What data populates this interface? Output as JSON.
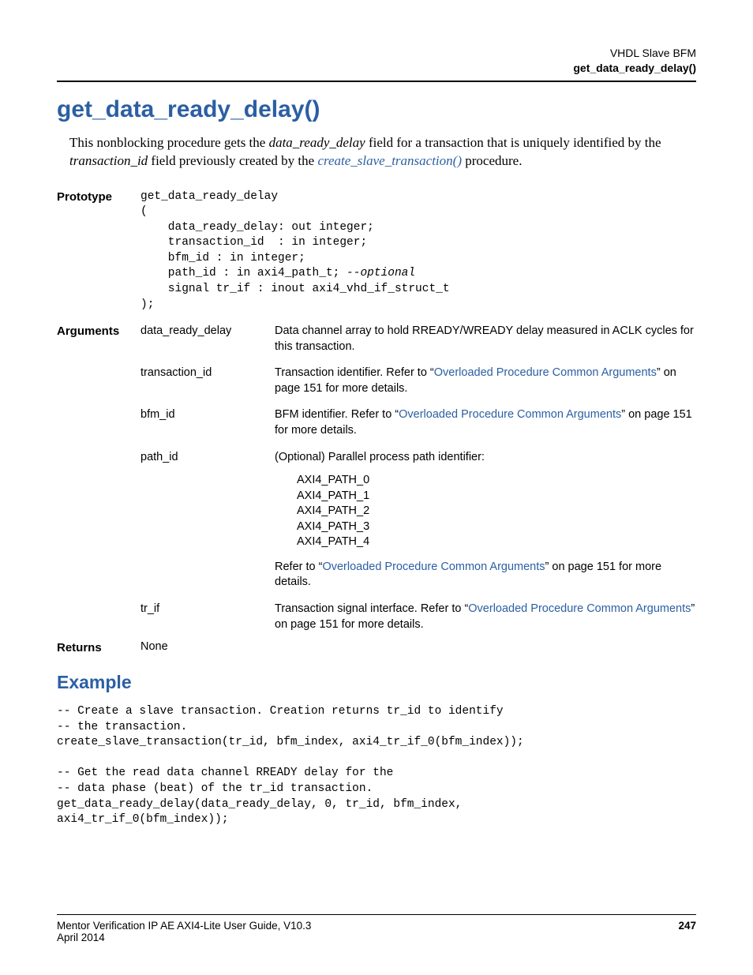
{
  "header": {
    "line1": "VHDL Slave BFM",
    "line2": "get_data_ready_delay()"
  },
  "title": "get_data_ready_delay()",
  "intro": {
    "pre1": "This nonblocking procedure gets the ",
    "em1": "data_ready_delay",
    "mid1": " field for a transaction that is uniquely identified by the ",
    "em2": "transaction_id",
    "mid2": " field previously created by the ",
    "link": "create_slave_transaction()",
    "post": " procedure."
  },
  "labels": {
    "prototype": "Prototype",
    "arguments": "Arguments",
    "returns": "Returns"
  },
  "prototype": {
    "l1": "get_data_ready_delay",
    "l2": "(",
    "l3": "    data_ready_delay: out integer;",
    "l4": "    transaction_id  : in integer;",
    "l5": "    bfm_id : in integer;",
    "l6a": "    path_id : in axi4_path_t; ",
    "l6b": "--optional",
    "l7": "    signal tr_if : inout axi4_vhd_if_struct_t",
    "l8": ");"
  },
  "args": {
    "a1": {
      "name": "data_ready_delay",
      "desc": "Data channel array to hold RREADY/WREADY delay measured in ACLK cycles for this transaction."
    },
    "a2": {
      "name": "transaction_id",
      "pre": "Transaction identifier. Refer to “",
      "link": "Overloaded Procedure Common Arguments",
      "post": "” on page 151 for more details."
    },
    "a3": {
      "name": "bfm_id",
      "pre": "BFM identifier. Refer to “",
      "link": "Overloaded Procedure Common Arguments",
      "post": "” on page 151 for more details."
    },
    "a4": {
      "name": "path_id",
      "desc": "(Optional) Parallel process path identifier:",
      "p0": "AXI4_PATH_0",
      "p1": "AXI4_PATH_1",
      "p2": "AXI4_PATH_2",
      "p3": "AXI4_PATH_3",
      "p4": "AXI4_PATH_4",
      "pre2": "Refer to “",
      "link2": "Overloaded Procedure Common Arguments",
      "post2": "” on page 151 for more details."
    },
    "a5": {
      "name": "tr_if",
      "pre": "Transaction signal interface. Refer to “",
      "link": "Overloaded Procedure Common Arguments",
      "post": "” on page 151 for more details."
    }
  },
  "returns": "None",
  "example_heading": "Example",
  "example": {
    "l1": "-- Create a slave transaction. Creation returns tr_id to identify",
    "l2": "-- the transaction.",
    "l3": "create_slave_transaction(tr_id, bfm_index, axi4_tr_if_0(bfm_index));",
    "l4": "",
    "l5": "-- Get the read data channel RREADY delay for the",
    "l6": "-- data phase (beat) of the tr_id transaction.",
    "l7": "get_data_ready_delay(data_ready_delay, 0, tr_id, bfm_index,",
    "l8": "axi4_tr_if_0(bfm_index));"
  },
  "footer": {
    "left": "Mentor Verification IP AE AXI4-Lite User Guide, V10.3",
    "date": "April 2014",
    "page": "247"
  }
}
